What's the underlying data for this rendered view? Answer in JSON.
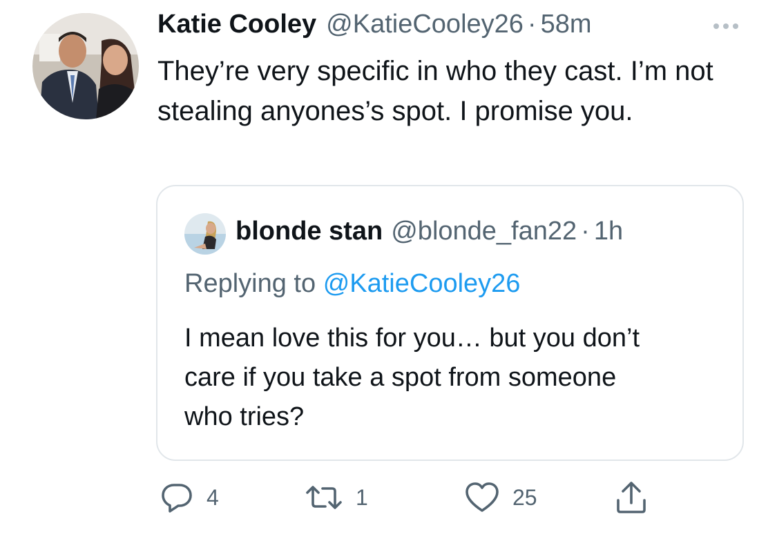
{
  "tweet": {
    "author_name": "Katie Cooley",
    "author_handle": "@KatieCooley26",
    "separator": "·",
    "time": "58m",
    "text": "They’re very specific in who they cast. I’m not stealing anyones’s spot. I promise you."
  },
  "quoted_tweet": {
    "author_name": "blonde stan",
    "author_handle": "@blonde_fan22",
    "separator": "·",
    "time": "1h",
    "replying_prefix": "Replying to",
    "replying_handle": "@KatieCooley26",
    "text": "I mean love this for you… but you don’t care if you take a spot from someone who tries?"
  },
  "actions": {
    "reply_count": "4",
    "retweet_count": "1",
    "like_count": "25"
  },
  "icons": {
    "more": "more-horizontal-icon",
    "reply": "reply-bubble-icon",
    "retweet": "retweet-icon",
    "like": "heart-icon",
    "share": "share-icon"
  },
  "colors": {
    "text": "#0f1419",
    "secondary": "#536471",
    "link": "#1d9bf0",
    "border": "#e1e6ea"
  }
}
